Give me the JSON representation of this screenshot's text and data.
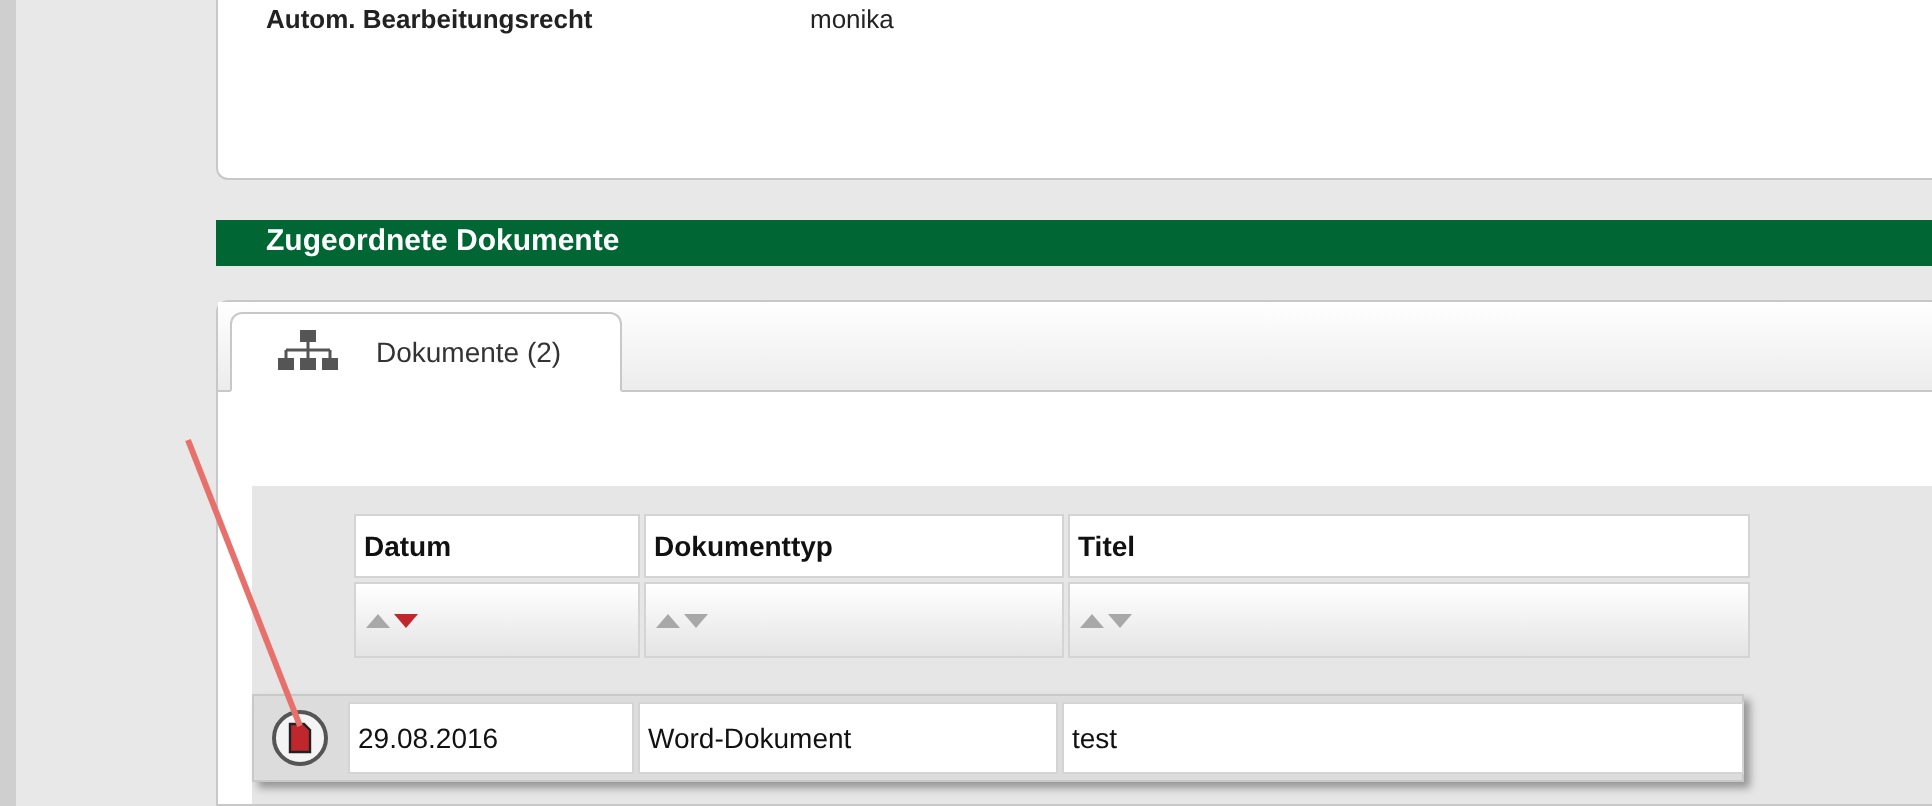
{
  "details": {
    "label": "Autom. Bearbeitungsrecht",
    "value": "monika"
  },
  "section_title": "Zugeordnete Dokumente",
  "tabs": [
    {
      "label": "Dokumente (2)",
      "selected": true
    }
  ],
  "table": {
    "columns": [
      {
        "label": "Datum",
        "sorted_descending": true
      },
      {
        "label": "Dokumenttyp",
        "sorted_descending": false
      },
      {
        "label": "Titel",
        "sorted_descending": false
      }
    ],
    "rows": [
      {
        "cells": [
          "29.08.2016",
          "Word-Dokument",
          "test"
        ]
      }
    ]
  }
}
